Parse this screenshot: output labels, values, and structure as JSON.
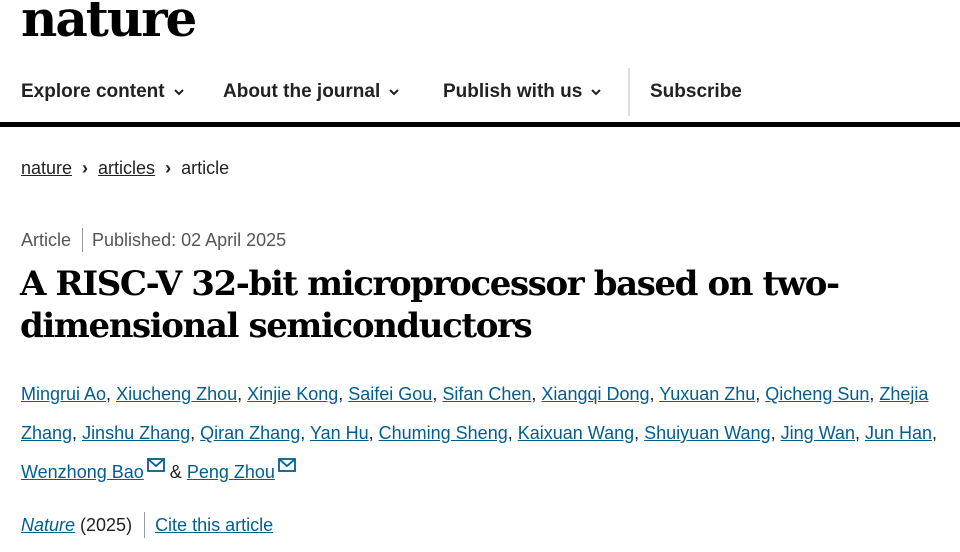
{
  "brand": {
    "logo": "nature"
  },
  "nav": {
    "explore": "Explore content",
    "about": "About the journal",
    "publish": "Publish with us",
    "subscribe": "Subscribe"
  },
  "breadcrumb": {
    "items": [
      "nature",
      "articles",
      "article"
    ]
  },
  "article": {
    "type": "Article",
    "published": "Published: 02 April 2025",
    "title": "A RISC-V 32-bit microprocessor based on two-dimensional semiconductors",
    "authors": [
      "Mingrui Ao",
      "Xiucheng Zhou",
      "Xinjie Kong",
      "Saifei Gou",
      "Sifan Chen",
      "Xiangqi Dong",
      "Yuxuan Zhu",
      "Qicheng Sun",
      "Zhejia Zhang",
      "Jinshu Zhang",
      "Qiran Zhang",
      "Yan Hu",
      "Chuming Sheng",
      "Kaixuan Wang",
      "Shuiyuan Wang",
      "Jing Wan",
      "Jun Han",
      "Wenzhong Bao",
      "Peng Zhou"
    ],
    "author_joiner": "&",
    "journal": "Nature",
    "year": "(2025)",
    "cite_label": "Cite this article"
  },
  "colors": {
    "link": "#025e8d",
    "text": "#222222",
    "rule": "#000000"
  },
  "icons": {
    "nav_dropdown": "chevron-down-icon",
    "breadcrumb_separator": "chevron-right-icon",
    "corresponding_author": "mail-icon"
  }
}
